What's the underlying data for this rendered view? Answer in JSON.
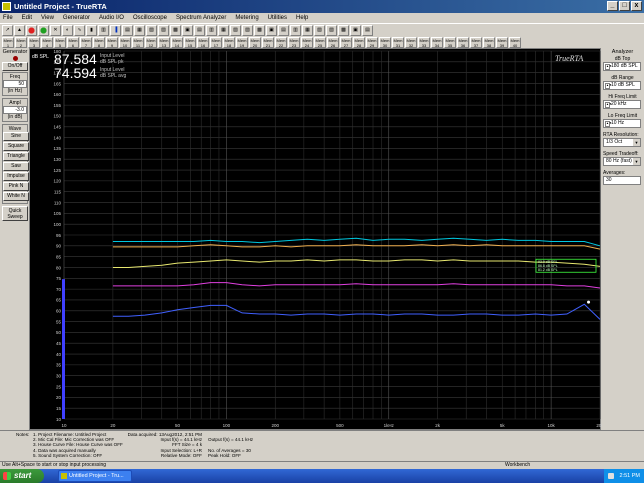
{
  "window": {
    "title": "Untitled Project - TrueRTA",
    "buttons": {
      "minimize": "_",
      "maximize": "□",
      "close": "x"
    }
  },
  "menu": [
    "File",
    "Edit",
    "View",
    "Generator",
    "Audio I/O",
    "Oscilloscope",
    "Spectrum Analyzer",
    "Metering",
    "Utilities",
    "Help"
  ],
  "toolbar2": [
    "Mem 1",
    "Mem 2",
    "Mem 3",
    "Mem 4",
    "Mem 5",
    "Mem 6",
    "Mem 7",
    "Mem 8",
    "Mem 9",
    "Mem 10",
    "Mem 11",
    "Mem 12",
    "Mem 13",
    "Mem 14",
    "Mem 15",
    "Mem 16",
    "Mem 17",
    "Mem 18",
    "Mem 19",
    "Mem 20",
    "Mem 21",
    "Mem 22",
    "Mem 23",
    "Mem 24",
    "Mem 25",
    "Mem 26",
    "Mem 27",
    "Mem 28",
    "Mem 29",
    "Mem 30",
    "Mem 31",
    "Mem 32",
    "Mem 33",
    "Mem 34",
    "Mem 35",
    "Mem 36",
    "Mem 37",
    "Mem 38",
    "Mem 39",
    "Mem 40"
  ],
  "generator": {
    "title": "Generator",
    "onoff": "On/Off",
    "freq_label": "Freq",
    "freq_value": "50",
    "freq_unit": "(in Hz)",
    "ampl_label": "Ampl",
    "ampl_value": "-3.0",
    "ampl_unit": "(in dB)",
    "wave_label": "Wave",
    "waves": [
      "Sine",
      "Square",
      "Triangle",
      "Saw",
      "Impulse",
      "Pink N",
      "White N"
    ],
    "quick_sweep": "Quick Sweep"
  },
  "readout": {
    "peak_value": "87.584",
    "peak_label1": "Input Level",
    "peak_label2": "dB SPL pk",
    "avg_value": "74.594",
    "avg_label1": "Input Level",
    "avg_label2": "dB SPL avg",
    "unit_top": "dB SPL",
    "brand": "TrueRTA"
  },
  "analyzer": {
    "title": "Analyzer",
    "db_top_label": "dB Top",
    "db_top_value": "180 dB SPL",
    "db_range_label": "dB Range",
    "db_range_value": "10 dB SPL",
    "hi_freq_label": "Hi Freq Limit",
    "hi_freq_value": "20 kHz",
    "lo_freq_label": "Lo Freq Limit",
    "lo_freq_value": "10 Hz",
    "resolution_label": "RTA Resolution:",
    "resolution_value": "1/3 Oct",
    "speed_label": "Speed Tradeoff:",
    "speed_value": "80 Hz (fast)",
    "averages_label": "Averages:",
    "averages_value": "30"
  },
  "notes": {
    "label": "Notes:",
    "col1": [
      "1. Project Filename: Untitled Project",
      "2. Mic Cal File: Mic Correction was OFF",
      "3. House Curve File: House Curve was OFF",
      "4. Data was acquired manually",
      "5. Sound System Correction: OFF"
    ],
    "col2": [
      "Data acquired: 13Aug2012, 2:51 PM",
      "Input f(s) = 44.1 kHz",
      "FFT Size = 4 k",
      "Input Selection: L+R",
      "Relative Mode: OFF"
    ],
    "col3": [
      "",
      "Output f(s) = 44.1 kHz",
      "",
      "No. of Averages = 30",
      "Peak Hold: OFF"
    ]
  },
  "status": {
    "hint": "Use Alt+Space to start or stop input processing",
    "workspace": "Workbench"
  },
  "taskbar": {
    "start": "start",
    "task": "Untitled Project - Tru...",
    "clock": "2:51 PM"
  },
  "chart_data": {
    "type": "line",
    "x_scale": "log",
    "xlim": [
      10,
      20000
    ],
    "ylim": [
      10,
      180
    ],
    "y_ticks": [
      180,
      175,
      170,
      165,
      160,
      155,
      150,
      145,
      140,
      135,
      130,
      125,
      120,
      115,
      110,
      105,
      100,
      95,
      90,
      85,
      80,
      75,
      70,
      65,
      60,
      55,
      50,
      45,
      40,
      35,
      30,
      25,
      20,
      15,
      10
    ],
    "x_ticks": [
      {
        "v": 10,
        "l": "10"
      },
      {
        "v": 20,
        "l": "20"
      },
      {
        "v": 50,
        "l": "50"
      },
      {
        "v": 100,
        "l": "100"
      },
      {
        "v": 200,
        "l": "200"
      },
      {
        "v": 500,
        "l": "500"
      },
      {
        "v": 1000,
        "l": "1kHz"
      },
      {
        "v": 2000,
        "l": "2k"
      },
      {
        "v": 5000,
        "l": "5k"
      },
      {
        "v": 10000,
        "l": "10k"
      },
      {
        "v": 20000,
        "l": "20k"
      }
    ],
    "grid": true,
    "input_level_bar": 74.6,
    "x": [
      20,
      25,
      31.5,
      40,
      50,
      63,
      80,
      100,
      125,
      160,
      200,
      250,
      315,
      400,
      500,
      630,
      800,
      1000,
      1250,
      1600,
      2000,
      2500,
      3150,
      4000,
      5000,
      6300,
      8000,
      10000,
      12500,
      16000,
      20000
    ],
    "series": [
      {
        "color": "#00c8e0",
        "values": [
          92,
          92,
          92,
          92,
          92,
          92,
          92.5,
          92,
          92,
          91.5,
          92,
          92.5,
          93,
          92.5,
          93,
          93.5,
          92.5,
          93,
          93,
          92.5,
          93,
          93.5,
          93,
          92.5,
          93,
          92.5,
          92.5,
          92,
          92,
          92,
          90
        ]
      },
      {
        "color": "#f0b050",
        "values": [
          89.5,
          89.5,
          89.5,
          89.5,
          89.5,
          90,
          90.5,
          90,
          89.5,
          89.5,
          90,
          89.5,
          90,
          90,
          90,
          90.5,
          90,
          90,
          90,
          90.5,
          90,
          90.5,
          90,
          90.5,
          90,
          90,
          90,
          90,
          90,
          90,
          88.5
        ]
      },
      {
        "color": "#e8e870",
        "values": [
          80,
          80,
          80.5,
          81,
          82,
          82.5,
          83,
          83.5,
          83,
          82.5,
          83,
          83,
          83.5,
          83,
          83.5,
          83.5,
          83,
          83,
          83.5,
          83.5,
          83,
          83.5,
          83,
          83,
          83,
          83,
          82.5,
          82.5,
          82,
          81.5,
          80.5
        ]
      },
      {
        "color": "#e040e0",
        "values": [
          71.5,
          71.5,
          71.5,
          71.5,
          71.5,
          72,
          73,
          73,
          72,
          71.5,
          72,
          72,
          72,
          72,
          72,
          72.5,
          72,
          72,
          72,
          72,
          72,
          72.5,
          72,
          72,
          72,
          72,
          72,
          72,
          71.5,
          71.5,
          70.5
        ]
      },
      {
        "color": "#4060ff",
        "values": [
          57.5,
          57.5,
          58,
          59,
          60.5,
          61.5,
          62.5,
          62.5,
          59,
          58.5,
          58.5,
          58,
          58.5,
          58.5,
          58,
          58.5,
          58.5,
          58,
          58.5,
          58.5,
          58,
          58,
          58.5,
          58.5,
          58,
          58,
          58.5,
          58,
          58.5,
          63,
          56
        ]
      }
    ],
    "peak_marker": {
      "x": 17000,
      "y": 64
    },
    "box_labels": [
      "93.9 dB SPL",
      "86.8 dB SPL",
      "81.2 dB SPL"
    ]
  }
}
